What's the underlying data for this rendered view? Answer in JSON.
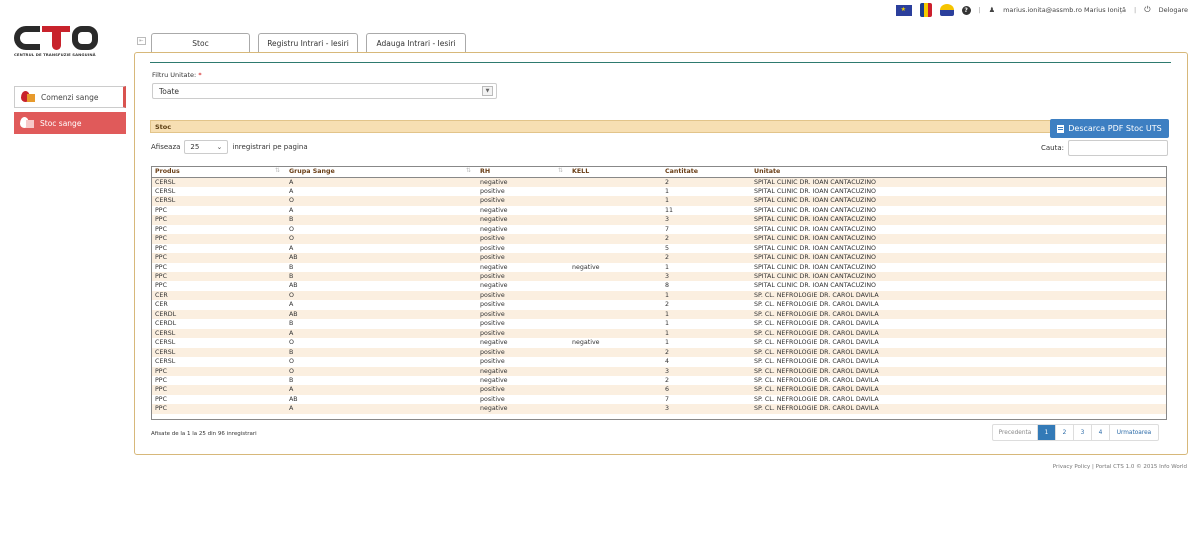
{
  "topbar": {
    "user": "marius.ionita@assmb.ro Marius Ioniță",
    "logout": "Delogare"
  },
  "logo": {
    "letters": "CTS",
    "tagline": "CENTRUL DE TRANSFUZIE SANGUINĂ"
  },
  "sidebar": {
    "items": [
      {
        "label": "Comenzi sange",
        "active": false
      },
      {
        "label": "Stoc sange",
        "active": true
      }
    ]
  },
  "tabs": [
    {
      "label": "Stoc",
      "active": true
    },
    {
      "label": "Registru Intrari - Iesiri",
      "active": false
    },
    {
      "label": "Adauga Intrari - Iesiri",
      "active": false
    }
  ],
  "filter": {
    "label": "Filtru Unitate:",
    "required_mark": "*",
    "value": "Toate"
  },
  "section": {
    "title": "Stoc",
    "pdf_button": "Descarca PDF Stoc UTS"
  },
  "length": {
    "prefix": "Afiseaza",
    "value": "25",
    "suffix": "inregistrari pe pagina"
  },
  "search": {
    "label": "Cauta:",
    "value": ""
  },
  "table": {
    "columns": [
      "Produs",
      "Grupa Sange",
      "RH",
      "KELL",
      "Cantitate",
      "Unitate"
    ],
    "rows": [
      [
        "CERSL",
        "A",
        "negative",
        "",
        "2",
        "SPITAL CLINIC DR. IOAN CANTACUZINO"
      ],
      [
        "CERSL",
        "A",
        "positive",
        "",
        "1",
        "SPITAL CLINIC DR. IOAN CANTACUZINO"
      ],
      [
        "CERSL",
        "O",
        "positive",
        "",
        "1",
        "SPITAL CLINIC DR. IOAN CANTACUZINO"
      ],
      [
        "PPC",
        "A",
        "negative",
        "",
        "11",
        "SPITAL CLINIC DR. IOAN CANTACUZINO"
      ],
      [
        "PPC",
        "B",
        "negative",
        "",
        "3",
        "SPITAL CLINIC DR. IOAN CANTACUZINO"
      ],
      [
        "PPC",
        "O",
        "negative",
        "",
        "7",
        "SPITAL CLINIC DR. IOAN CANTACUZINO"
      ],
      [
        "PPC",
        "O",
        "positive",
        "",
        "2",
        "SPITAL CLINIC DR. IOAN CANTACUZINO"
      ],
      [
        "PPC",
        "A",
        "positive",
        "",
        "5",
        "SPITAL CLINIC DR. IOAN CANTACUZINO"
      ],
      [
        "PPC",
        "AB",
        "positive",
        "",
        "2",
        "SPITAL CLINIC DR. IOAN CANTACUZINO"
      ],
      [
        "PPC",
        "B",
        "negative",
        "negative",
        "1",
        "SPITAL CLINIC DR. IOAN CANTACUZINO"
      ],
      [
        "PPC",
        "B",
        "positive",
        "",
        "3",
        "SPITAL CLINIC DR. IOAN CANTACUZINO"
      ],
      [
        "PPC",
        "AB",
        "negative",
        "",
        "8",
        "SPITAL CLINIC DR. IOAN CANTACUZINO"
      ],
      [
        "CER",
        "O",
        "positive",
        "",
        "1",
        "SP. CL. NEFROLOGIE DR. CAROL DAVILA"
      ],
      [
        "CER",
        "A",
        "positive",
        "",
        "2",
        "SP. CL. NEFROLOGIE DR. CAROL DAVILA"
      ],
      [
        "CERDL",
        "AB",
        "positive",
        "",
        "1",
        "SP. CL. NEFROLOGIE DR. CAROL DAVILA"
      ],
      [
        "CERDL",
        "B",
        "positive",
        "",
        "1",
        "SP. CL. NEFROLOGIE DR. CAROL DAVILA"
      ],
      [
        "CERSL",
        "A",
        "positive",
        "",
        "1",
        "SP. CL. NEFROLOGIE DR. CAROL DAVILA"
      ],
      [
        "CERSL",
        "O",
        "negative",
        "negative",
        "1",
        "SP. CL. NEFROLOGIE DR. CAROL DAVILA"
      ],
      [
        "CERSL",
        "B",
        "positive",
        "",
        "2",
        "SP. CL. NEFROLOGIE DR. CAROL DAVILA"
      ],
      [
        "CERSL",
        "O",
        "positive",
        "",
        "4",
        "SP. CL. NEFROLOGIE DR. CAROL DAVILA"
      ],
      [
        "PPC",
        "O",
        "negative",
        "",
        "3",
        "SP. CL. NEFROLOGIE DR. CAROL DAVILA"
      ],
      [
        "PPC",
        "B",
        "negative",
        "",
        "2",
        "SP. CL. NEFROLOGIE DR. CAROL DAVILA"
      ],
      [
        "PPC",
        "A",
        "positive",
        "",
        "6",
        "SP. CL. NEFROLOGIE DR. CAROL DAVILA"
      ],
      [
        "PPC",
        "AB",
        "positive",
        "",
        "7",
        "SP. CL. NEFROLOGIE DR. CAROL DAVILA"
      ],
      [
        "PPC",
        "A",
        "negative",
        "",
        "3",
        "SP. CL. NEFROLOGIE DR. CAROL DAVILA"
      ]
    ]
  },
  "info": "Afisate de la 1 la 25 din 96 inregistrari",
  "pagination": {
    "prev": "Precedenta",
    "pages": [
      "1",
      "2",
      "3",
      "4"
    ],
    "current": "1",
    "next": "Urmatoarea"
  },
  "footer": "Privacy Policy | Portal CTS 1.0 © 2015 Info World"
}
